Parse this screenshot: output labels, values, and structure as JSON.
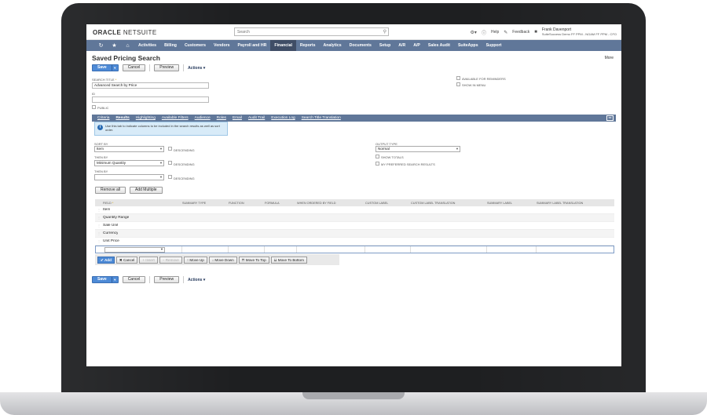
{
  "header": {
    "logo_brand": "ORACLE",
    "logo_product": "NETSUITE",
    "search_placeholder": "Search",
    "help_label": "Help",
    "feedback_label": "Feedback",
    "user_name": "Frank Davenport",
    "user_role": "SuiteSuccess Demo FF PPM - NGAM FF PPM - CFO"
  },
  "nav": {
    "items": [
      "Activities",
      "Billing",
      "Customers",
      "Vendors",
      "Payroll and HR",
      "Financial",
      "Reports",
      "Analytics",
      "Documents",
      "Setup",
      "A/R",
      "A/P",
      "Sales Audit",
      "SuiteApps",
      "Support"
    ],
    "active_index": 5
  },
  "page": {
    "title": "Saved Pricing Search",
    "more_label": "More"
  },
  "buttons": {
    "save": "Save",
    "cancel": "Cancel",
    "preview": "Preview",
    "actions": "Actions ▾"
  },
  "form": {
    "search_title_label": "Search Title",
    "search_title_value": "Advanced Search by Price",
    "id_label": "ID",
    "id_value": "",
    "public_label": "Public",
    "available_for_reminders_label": "Available for Reminders",
    "show_in_menu_label": "Show in Menu"
  },
  "subtabs": [
    "Criteria",
    "Results",
    "Highlighting",
    "Available Filters",
    "Audience",
    "Roles",
    "Email",
    "Audit Trail",
    "Execution Log",
    "Search Title Translation"
  ],
  "info_text": "Use this tab to indicate columns to be included in the search results as well as sort order.",
  "sorting": {
    "sort_by_label": "Sort By",
    "sort_by_value": "Item",
    "then_by_label": "Then By",
    "then_by_value": "Minimum Quantity",
    "then_by2_label": "Then By",
    "then_by2_value": "",
    "descending_label": "Descending",
    "output_type_label": "Output Type",
    "output_type_value": "Normal",
    "show_totals_label": "Show Totals",
    "preferred_label": "My Preferred Search Results",
    "remove_all": "Remove all",
    "add_multiple": "Add Multiple"
  },
  "grid": {
    "columns": [
      "Field",
      "Summary Type",
      "Function",
      "Formula",
      "When Ordered By Field",
      "Custom Label",
      "Custom Label Translation",
      "Summary Label",
      "Summary Label Translation"
    ],
    "rows": [
      "Item",
      "Quantity Range",
      "Sale Unit",
      "Currency",
      "Unit Price"
    ],
    "buttons": {
      "add": "✔ Add",
      "cancel": "✖ Cancel",
      "insert": "+ Insert",
      "remove": "− Remove",
      "move_up": "↑ Move Up",
      "move_down": "↓ Move Down",
      "move_top": "⇈ Move To Top",
      "move_bottom": "⇊ Move To Bottom"
    }
  },
  "colors": {
    "nav_bg": "#607799",
    "nav_active": "#3f4d66",
    "save_blue": "#4d8ad6"
  }
}
